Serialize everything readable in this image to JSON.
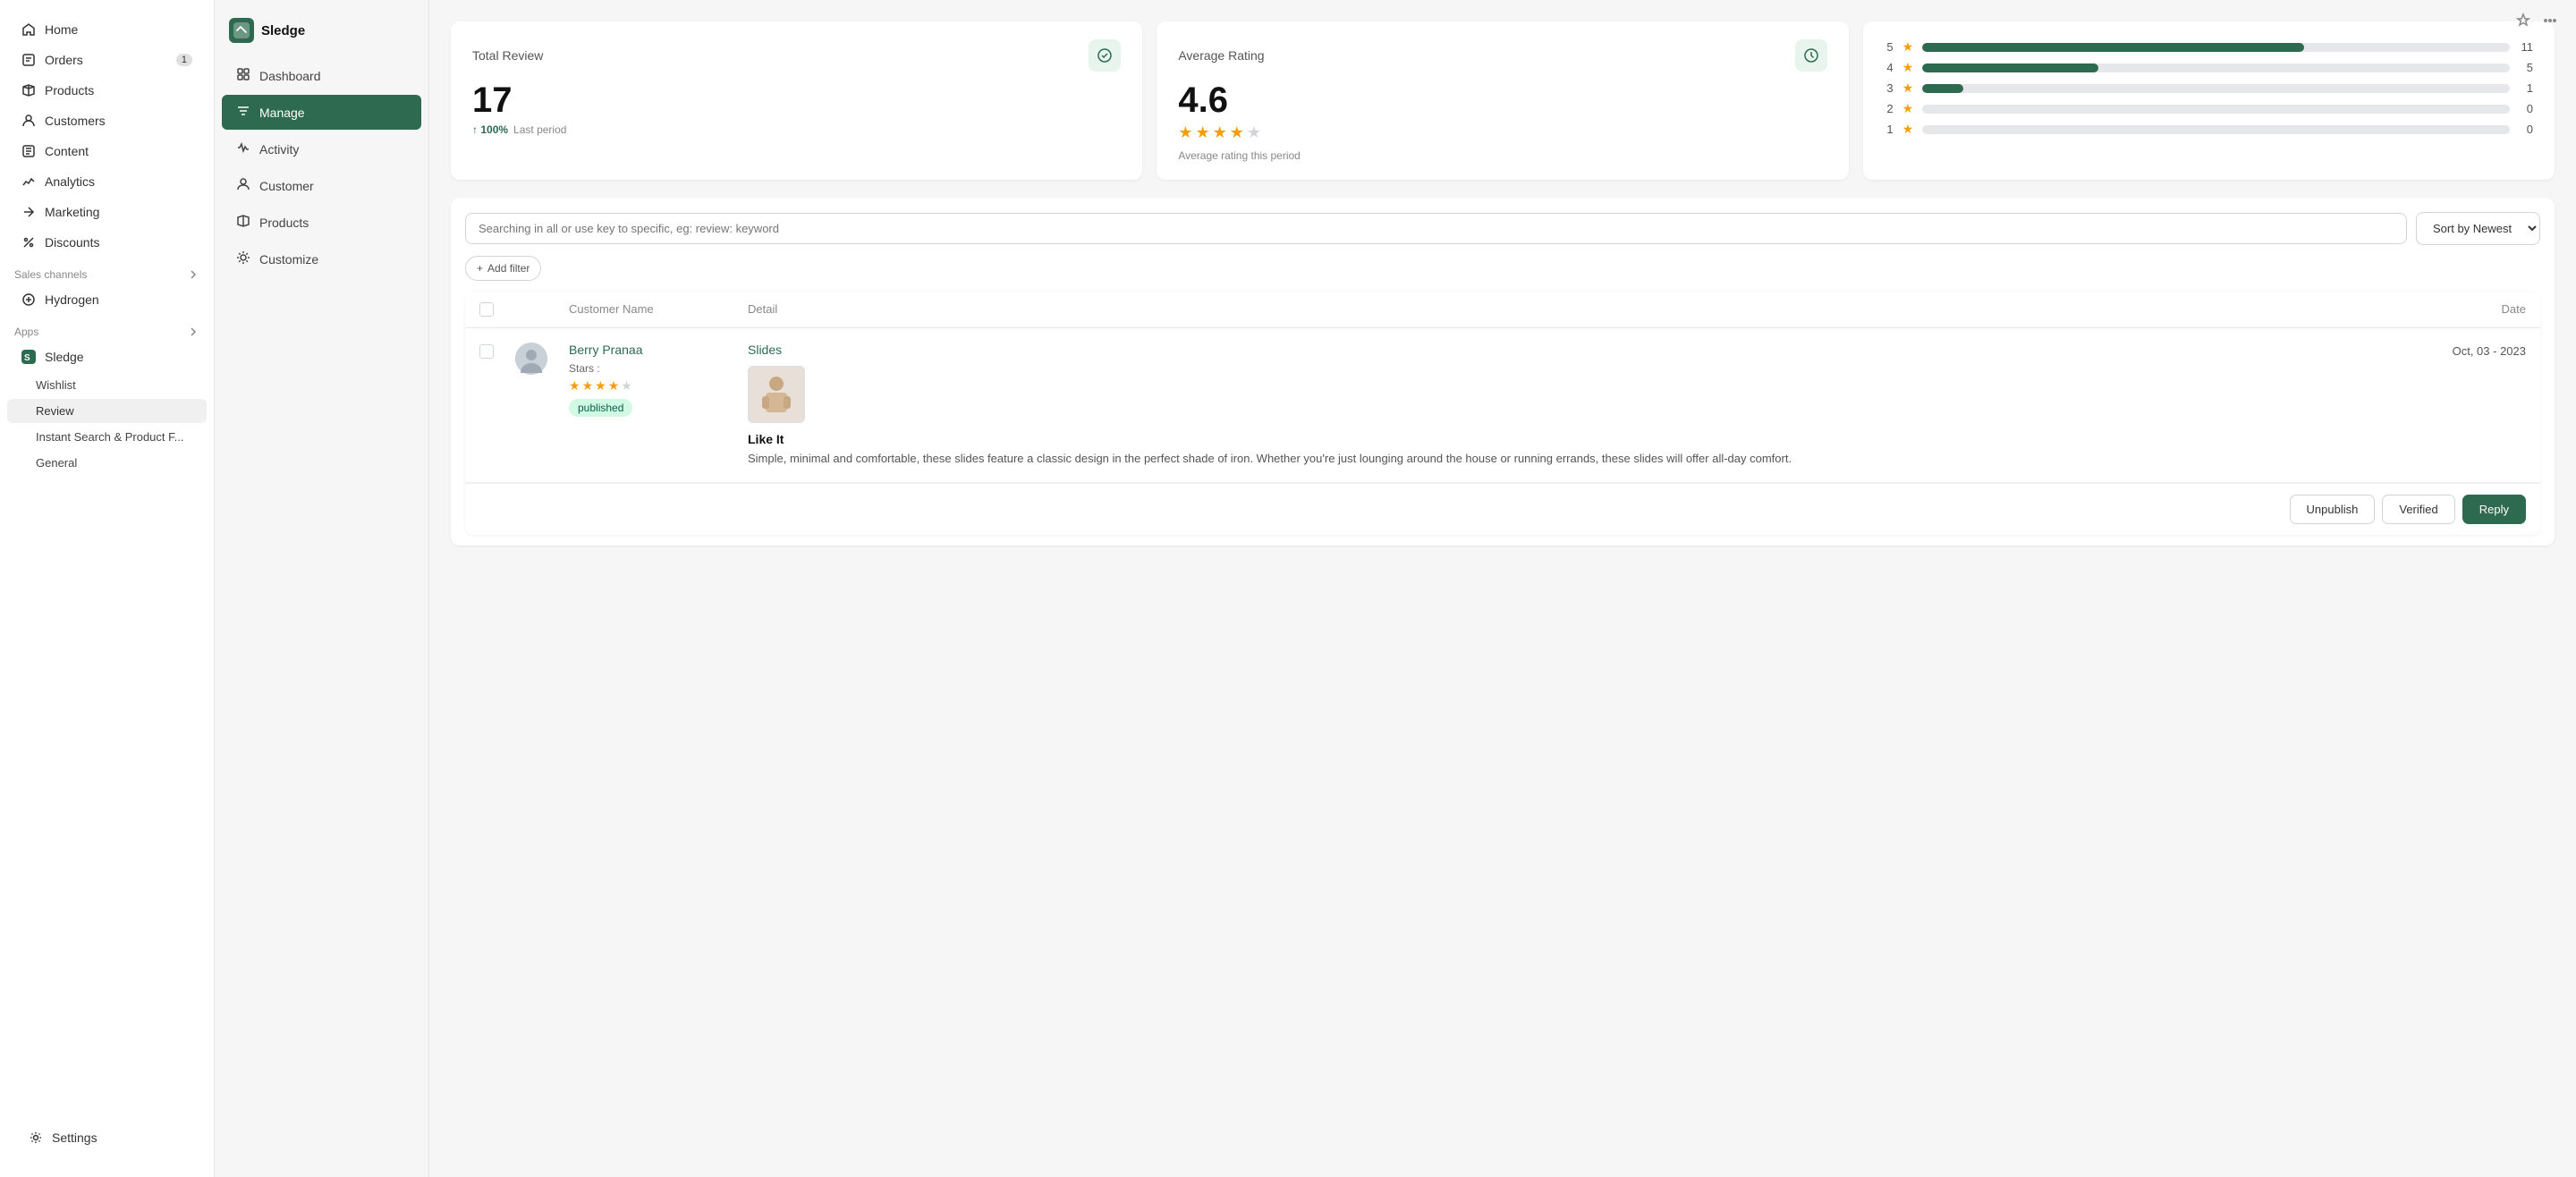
{
  "app": {
    "name": "Sledge",
    "logo_text": "S"
  },
  "sidebar": {
    "nav_items": [
      {
        "id": "home",
        "label": "Home",
        "icon": "home-icon",
        "badge": null
      },
      {
        "id": "orders",
        "label": "Orders",
        "icon": "orders-icon",
        "badge": "1"
      },
      {
        "id": "products",
        "label": "Products",
        "icon": "products-icon",
        "badge": null
      },
      {
        "id": "customers",
        "label": "Customers",
        "icon": "customers-icon",
        "badge": null
      },
      {
        "id": "content",
        "label": "Content",
        "icon": "content-icon",
        "badge": null
      },
      {
        "id": "analytics",
        "label": "Analytics",
        "icon": "analytics-icon",
        "badge": null
      },
      {
        "id": "marketing",
        "label": "Marketing",
        "icon": "marketing-icon",
        "badge": null
      },
      {
        "id": "discounts",
        "label": "Discounts",
        "icon": "discounts-icon",
        "badge": null
      }
    ],
    "sales_channels": {
      "label": "Sales channels",
      "items": [
        {
          "id": "hydrogen",
          "label": "Hydrogen",
          "icon": "hydrogen-icon"
        }
      ]
    },
    "apps": {
      "label": "Apps",
      "items": [
        {
          "id": "sledge",
          "label": "Sledge",
          "icon": "sledge-icon"
        },
        {
          "id": "wishlist",
          "label": "Wishlist",
          "sub": true
        },
        {
          "id": "review",
          "label": "Review",
          "sub": true,
          "active": true
        },
        {
          "id": "instant-search",
          "label": "Instant Search & Product F...",
          "sub": true
        },
        {
          "id": "general",
          "label": "General",
          "sub": true
        }
      ]
    },
    "settings": {
      "label": "Settings",
      "icon": "settings-icon"
    }
  },
  "sub_sidebar": {
    "title": "Sledge",
    "items": [
      {
        "id": "dashboard",
        "label": "Dashboard",
        "icon": "dashboard-icon",
        "active": false
      },
      {
        "id": "manage",
        "label": "Manage",
        "icon": "manage-icon",
        "active": true
      },
      {
        "id": "activity",
        "label": "Activity",
        "icon": "activity-icon",
        "active": false
      },
      {
        "id": "customer",
        "label": "Customer",
        "icon": "customer-icon",
        "active": false
      },
      {
        "id": "products",
        "label": "Products",
        "icon": "products2-icon",
        "active": false
      },
      {
        "id": "customize",
        "label": "Customize",
        "icon": "customize-icon",
        "active": false
      }
    ]
  },
  "stats": {
    "total_review": {
      "title": "Total Review",
      "value": "17",
      "change_pct": "100%",
      "change_label": "Last period",
      "icon": "review-icon"
    },
    "average_rating": {
      "title": "Average Rating",
      "value": "4.6",
      "sub_label": "Average rating this period",
      "icon": "rating-icon",
      "stars": [
        1,
        1,
        1,
        1,
        0
      ]
    },
    "rating_bars": {
      "rows": [
        {
          "num": "5",
          "pct": 65,
          "count": "11"
        },
        {
          "num": "4",
          "pct": 30,
          "count": "5"
        },
        {
          "num": "3",
          "pct": 6,
          "count": "1"
        },
        {
          "num": "2",
          "pct": 0,
          "count": "0"
        },
        {
          "num": "1",
          "pct": 0,
          "count": "0"
        }
      ]
    }
  },
  "search": {
    "placeholder": "Searching in all or use key to specific, eg: review: keyword",
    "sort_label": "Sort by Newest",
    "add_filter_label": "Add filter +"
  },
  "table": {
    "headers": {
      "customer_name": "Customer Name",
      "detail": "Detail",
      "date": "Date"
    },
    "rows": [
      {
        "id": "1",
        "customer_name": "Berry Pranaa",
        "stars": [
          1,
          1,
          1,
          1,
          0
        ],
        "status": "published",
        "product_name": "Slides",
        "date": "Oct, 03 - 2023",
        "review_title": "Like It",
        "review_text": "Simple, minimal and comfortable, these slides feature a classic design in the perfect shade of iron. Whether you're just lounging around the house or running errands, these slides will offer all-day comfort."
      }
    ]
  },
  "actions": {
    "unpublish": "Unpublish",
    "verified": "Verified",
    "reply": "Reply"
  }
}
